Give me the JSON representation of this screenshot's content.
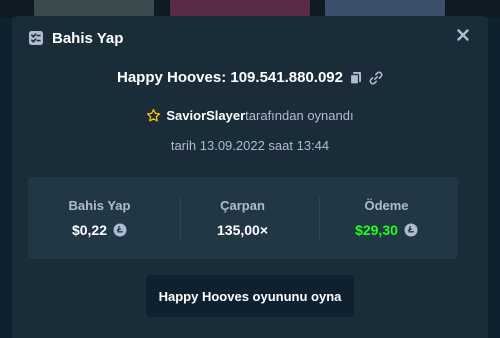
{
  "modal": {
    "title": "Bahis Yap",
    "header_icon": "bet-slip-icon",
    "close_icon": "close-icon"
  },
  "bet": {
    "game_name": "Happy Hooves",
    "separator": ": ",
    "bet_id": "109.541.880.092",
    "copy_icon": "copy-icon",
    "link_icon": "link-icon",
    "player_name": "SaviorSlayer",
    "played_by_suffix": "tarafından oynandı",
    "date_text": "tarih 13.09.2022 saat 13:44"
  },
  "stats": {
    "bet_label": "Bahis Yap",
    "bet_amount": "$0,22",
    "multiplier_label": "Çarpan",
    "multiplier_value": "135,00×",
    "payout_label": "Ödeme",
    "payout_amount": "$29,30",
    "currency_icon": "litecoin-icon"
  },
  "actions": {
    "play_game_label": "Happy Hooves oyununu oyna"
  },
  "colors": {
    "modal_bg": "#1a2c38",
    "stats_bg": "#213743",
    "button_bg": "#0f212e",
    "muted_text": "#b1bad3",
    "payout_green": "#1fff20",
    "star_yellow": "#ffc800"
  }
}
